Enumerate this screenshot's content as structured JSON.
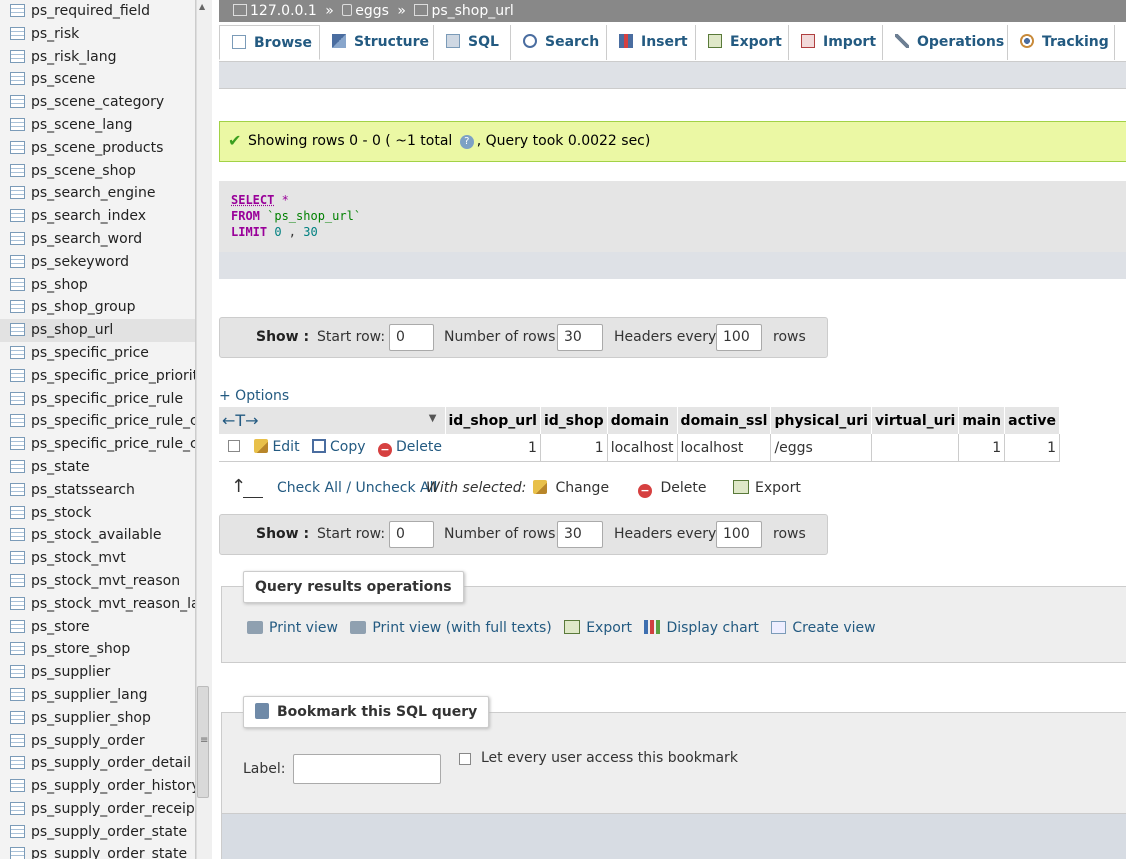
{
  "sidebar": {
    "tables": [
      "ps_required_field",
      "ps_risk",
      "ps_risk_lang",
      "ps_scene",
      "ps_scene_category",
      "ps_scene_lang",
      "ps_scene_products",
      "ps_scene_shop",
      "ps_search_engine",
      "ps_search_index",
      "ps_search_word",
      "ps_sekeyword",
      "ps_shop",
      "ps_shop_group",
      "ps_shop_url",
      "ps_specific_price",
      "ps_specific_price_priority",
      "ps_specific_price_rule",
      "ps_specific_price_rule_co",
      "ps_specific_price_rule_co",
      "ps_state",
      "ps_statssearch",
      "ps_stock",
      "ps_stock_available",
      "ps_stock_mvt",
      "ps_stock_mvt_reason",
      "ps_stock_mvt_reason_lan",
      "ps_store",
      "ps_store_shop",
      "ps_supplier",
      "ps_supplier_lang",
      "ps_supplier_shop",
      "ps_supply_order",
      "ps_supply_order_detail",
      "ps_supply_order_history",
      "ps_supply_order_receipt_",
      "ps_supply_order_state",
      "ps_supply_order_state_la"
    ],
    "active_table": "ps_shop_url"
  },
  "breadcrumb": {
    "server": "127.0.0.1",
    "sep1": "»",
    "database": "eggs",
    "sep2": "»",
    "table": "ps_shop_url"
  },
  "tabs": {
    "browse": "Browse",
    "structure": "Structure",
    "sql": "SQL",
    "search": "Search",
    "insert": "Insert",
    "export": "Export",
    "import": "Import",
    "operations": "Operations",
    "tracking": "Tracking"
  },
  "success": {
    "message_a": "Showing rows 0 - 0 ( ~1 total",
    "help": "?",
    "message_b": ", Query took 0.0022 sec)"
  },
  "sql": {
    "select_kw": "SELECT",
    "select_rest": " *",
    "from_kw": "FROM",
    "from_rest": " `ps_shop_url`",
    "limit_kw": "LIMIT",
    "limit_a": " 0",
    "limit_sep": " , ",
    "limit_b": "30"
  },
  "showbar": {
    "show_label": "Show :",
    "start_row_label": "Start row:",
    "start_row_value": "0",
    "num_rows_label": "Number of rows:",
    "num_rows_value": "30",
    "headers_every_label": "Headers every",
    "headers_every_value": "100",
    "rows_label": "rows"
  },
  "options_link": "+ Options",
  "table": {
    "arrows": "←T→",
    "sort_indicator": "▼",
    "columns": [
      "id_shop_url",
      "id_shop",
      "domain",
      "domain_ssl",
      "physical_uri",
      "virtual_uri",
      "main",
      "active"
    ],
    "actions": {
      "edit": "Edit",
      "copy": "Copy",
      "delete": "Delete"
    },
    "rows": [
      {
        "id_shop_url": "1",
        "id_shop": "1",
        "domain": "localhost",
        "domain_ssl": "localhost",
        "physical_uri": "/eggs",
        "virtual_uri": "",
        "main": "1",
        "active": "1"
      }
    ]
  },
  "bulk": {
    "arrow": "↑",
    "check_all": "Check All / Uncheck All",
    "with_selected": "With selected:",
    "change": "Change",
    "delete": "Delete",
    "export": "Export"
  },
  "query_ops": {
    "legend": "Query results operations",
    "print_view": "Print view",
    "print_view_full": "Print view (with full texts)",
    "export": "Export",
    "display_chart": "Display chart",
    "create_view": "Create view"
  },
  "bookmark": {
    "legend": "Bookmark this SQL query",
    "label": "Label:",
    "label_value": "",
    "let_every_user": "Let every user access this bookmark"
  },
  "colors": {
    "link": "#235a81",
    "success_bg": "#ebf8a4",
    "keyword": "#990099"
  }
}
